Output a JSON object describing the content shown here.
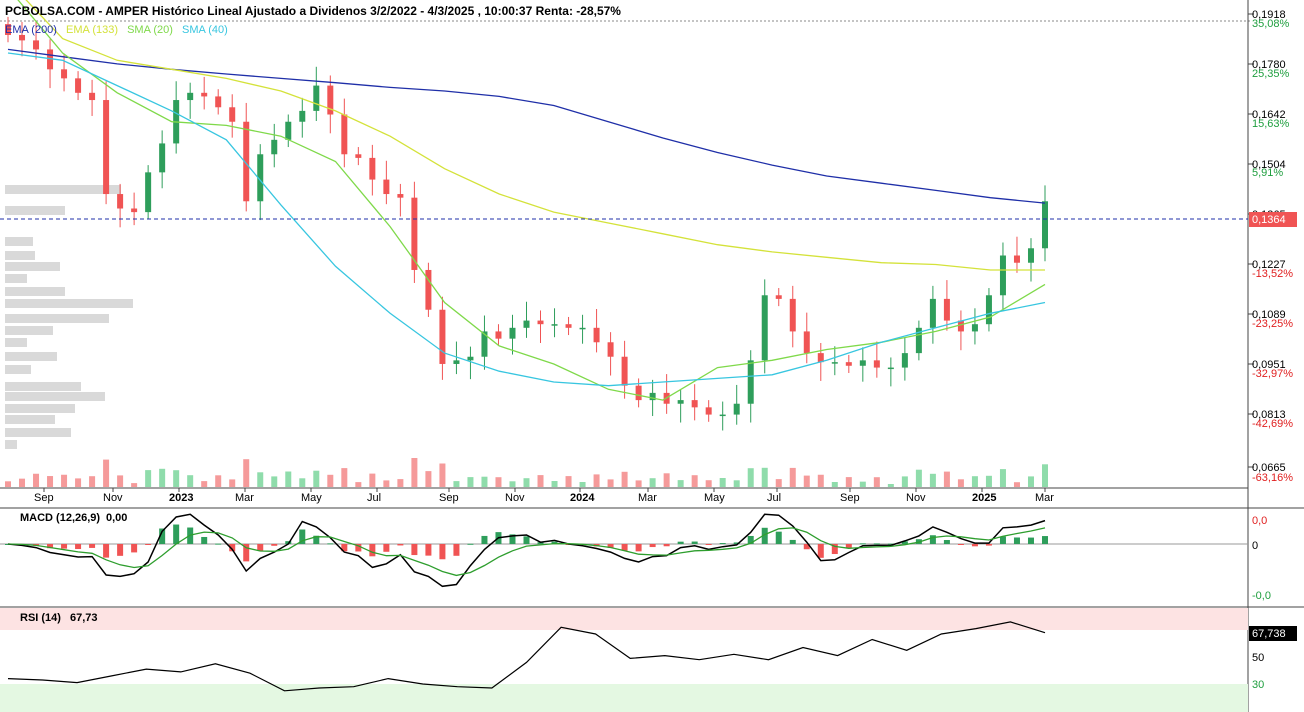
{
  "header": {
    "title": "PCBOLSA.COM - AMPER Histórico Lineal Ajustado a Dividenos 3/2/2022 - 4/3/2025 , 10:00:37 Renta: -28,57%"
  },
  "legend": [
    {
      "label": "EMA (200)",
      "color": "#1f2fa8"
    },
    {
      "label": "EMA (133)",
      "color": "#d4e23a"
    },
    {
      "label": "SMA (20)",
      "color": "#7fd94a"
    },
    {
      "label": "SMA (40)",
      "color": "#38c6e0"
    }
  ],
  "colors": {
    "up": "#2e9e5b",
    "down": "#f05454",
    "vol_up": "#8fdcab",
    "vol_down": "#f59a9a",
    "profile": "#d9d9d9"
  },
  "price_axis": {
    "labels": [
      "0,1918",
      "0,1780",
      "0,1642",
      "0,1504",
      "0,1365",
      "0,1227",
      "0,1089",
      "0,0951",
      "0,0813",
      "0,0665"
    ],
    "pct_labels": [
      "35,08%",
      "25,35%",
      "15,63%",
      "5,91%",
      "-13,52%",
      "-23,25%",
      "-32,97%",
      "-42,69%",
      "-63,16%"
    ],
    "current": "0,1364"
  },
  "x_axis": {
    "labels": [
      "Sep",
      "Nov",
      "2023",
      "Mar",
      "May",
      "Jul",
      "Sep",
      "Nov",
      "2024",
      "Mar",
      "May",
      "Jul",
      "Sep",
      "Nov",
      "2025",
      "Mar"
    ]
  },
  "macd": {
    "title": "MACD (12,26,9)",
    "value": "0,00",
    "axis": [
      "0,0",
      "0",
      "-0,0"
    ]
  },
  "rsi": {
    "title": "RSI (14)",
    "value": "67,73",
    "current": "67,738",
    "axis": [
      "50",
      "30"
    ]
  },
  "chart_data": {
    "type": "candlestick",
    "title": "PCBOLSA.COM - AMPER Histórico Lineal Ajustado a Dividenos 3/2/2022 - 4/3/2025 , 10:00:37 Renta: -28,57%",
    "x_range": [
      "2022-08",
      "2025-03"
    ],
    "ylim": [
      0.0665,
      0.1918
    ],
    "last_close": 0.1364,
    "closes": [
      0.186,
      0.1845,
      0.182,
      0.1765,
      0.174,
      0.17,
      0.168,
      0.142,
      0.138,
      0.137,
      0.148,
      0.156,
      0.168,
      0.17,
      0.169,
      0.166,
      0.162,
      0.14,
      0.153,
      0.157,
      0.162,
      0.165,
      0.172,
      0.164,
      0.153,
      0.152,
      0.146,
      0.142,
      0.141,
      0.121,
      0.11,
      0.095,
      0.096,
      0.097,
      0.104,
      0.102,
      0.105,
      0.107,
      0.106,
      0.106,
      0.105,
      0.105,
      0.101,
      0.097,
      0.089,
      0.085,
      0.087,
      0.084,
      0.085,
      0.083,
      0.081,
      0.081,
      0.084,
      0.096,
      0.114,
      0.113,
      0.104,
      0.098,
      0.0955,
      0.0955,
      0.0945,
      0.096,
      0.094,
      0.094,
      0.098,
      0.105,
      0.113,
      0.107,
      0.104,
      0.106,
      0.114,
      0.125,
      0.123,
      0.127,
      0.14
    ],
    "ema_200": [
      0.182,
      0.18,
      0.178,
      0.1765,
      0.1752,
      0.174,
      0.1728,
      0.1715,
      0.1705,
      0.169,
      0.1665,
      0.162,
      0.1575,
      0.1535,
      0.15,
      0.147,
      0.145,
      0.143,
      0.141,
      0.1395
    ],
    "ema_133": [
      0.201,
      0.185,
      0.179,
      0.1765,
      0.174,
      0.1705,
      0.165,
      0.158,
      0.149,
      0.142,
      0.137,
      0.134,
      0.131,
      0.128,
      0.126,
      0.1245,
      0.123,
      0.1225,
      0.121,
      0.121
    ],
    "sma_20": [
      0.199,
      0.181,
      0.17,
      0.162,
      0.161,
      0.158,
      0.151,
      0.133,
      0.112,
      0.1,
      0.095,
      0.088,
      0.085,
      0.094,
      0.096,
      0.099,
      0.101,
      0.104,
      0.108,
      0.117
    ],
    "sma_40": [
      0.181,
      0.179,
      0.172,
      0.165,
      0.157,
      0.139,
      0.122,
      0.109,
      0.098,
      0.093,
      0.09,
      0.089,
      0.09,
      0.091,
      0.092,
      0.096,
      0.101,
      0.105,
      0.109,
      0.112
    ],
    "rsi": [
      34,
      33,
      31,
      36,
      41,
      39,
      45,
      38,
      25,
      27,
      28,
      34,
      30,
      28,
      27,
      46,
      72,
      67,
      49,
      51,
      48,
      52,
      48,
      57,
      51,
      63,
      55,
      67,
      71,
      76,
      68
    ],
    "rsi_levels": [
      70,
      30
    ]
  }
}
